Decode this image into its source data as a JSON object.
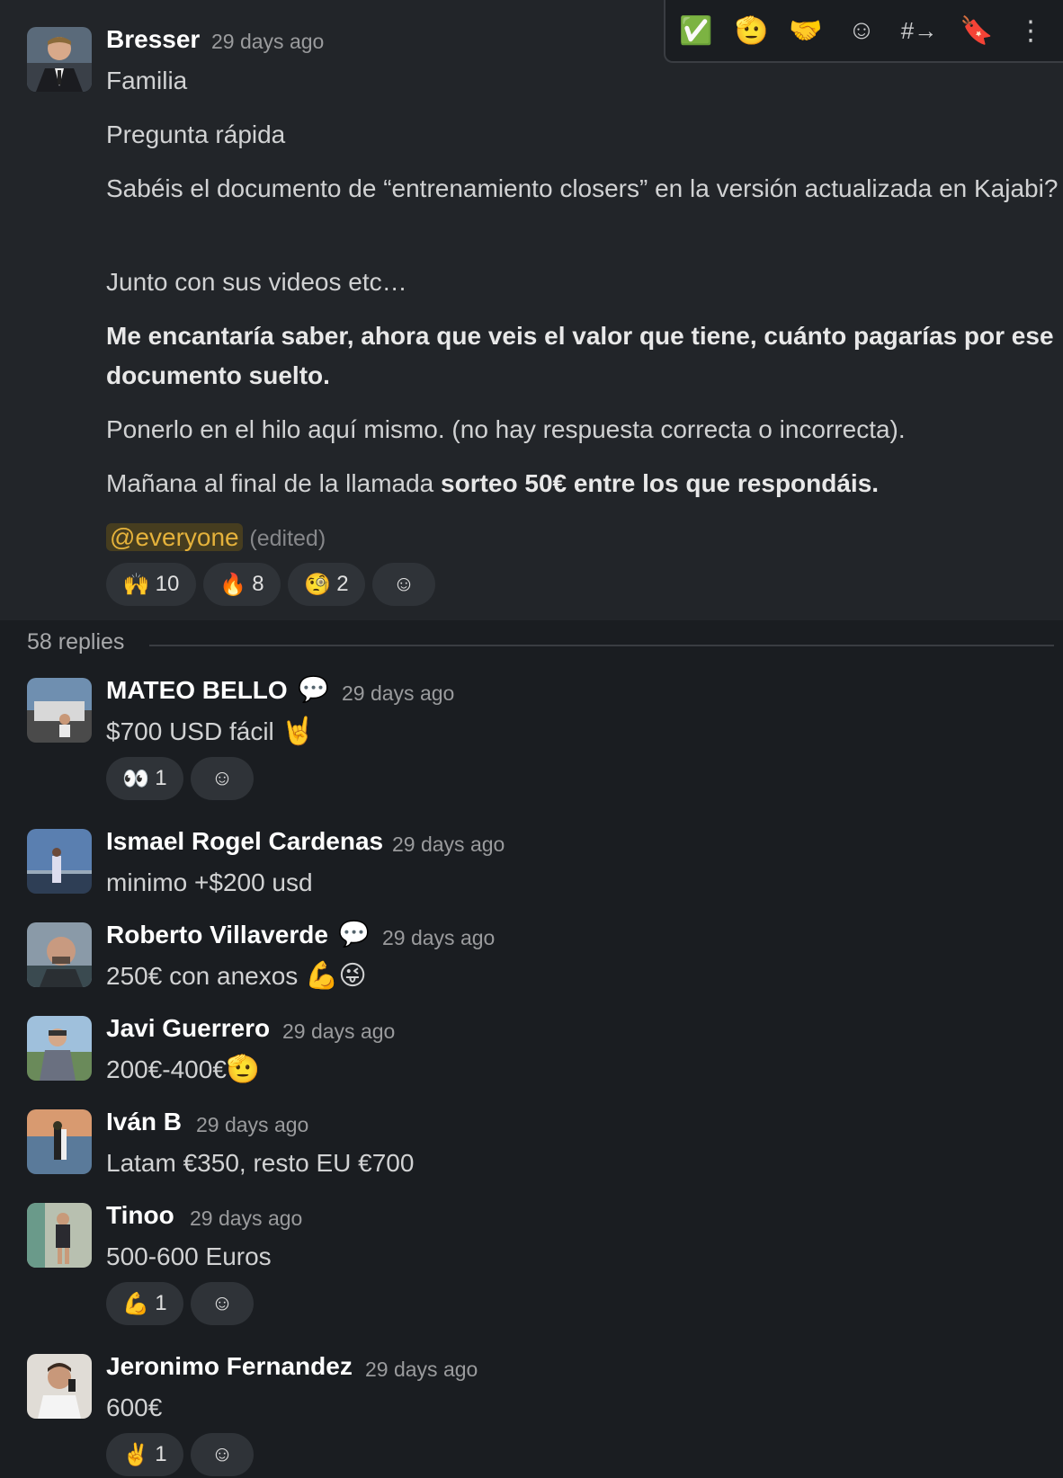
{
  "toolbar": {
    "icons": [
      "check-mark",
      "pointing-hand",
      "handshake",
      "add-reaction",
      "channel-link",
      "bookmark",
      "more"
    ],
    "glyphs": [
      "✅",
      "🫡",
      "🤝",
      "☺",
      "#→",
      "🔖",
      "⋮"
    ]
  },
  "parent": {
    "author": "Bresser",
    "time": "29 days ago",
    "lines": {
      "l1": "Familia",
      "l2": "Pregunta rápida",
      "l3": "Sabéis el documento de “entrenamiento closers” en la versión actualizada en Kajabi?",
      "l4": "Junto con sus videos etc…",
      "l5": "Me encantaría saber, ahora que veis el valor que tiene, cuánto pagarías por ese documento suelto.",
      "l6": "Ponerlo en el hilo aquí mismo. (no hay respuesta correcta o incorrecta).",
      "l7a": "Mañana al final de la llamada ",
      "l7b": "sorteo 50€ entre los que respondáis."
    },
    "mention": "@everyone",
    "edited": "(edited)",
    "reactions": [
      {
        "emoji": "🙌",
        "count": "10"
      },
      {
        "emoji": "🔥",
        "count": "8"
      },
      {
        "emoji": "🧐",
        "count": "2"
      }
    ]
  },
  "replies_label": "58 replies",
  "replies": [
    {
      "author": "MATEO BELLO",
      "badge": "💬",
      "time": "29 days ago",
      "text": "$700 USD fácil",
      "emoji": "🤘",
      "reaction": {
        "emoji": "👀",
        "count": "1"
      }
    },
    {
      "author": "Ismael Rogel Cardenas",
      "time": "29 days ago",
      "text": "minimo +$200 usd"
    },
    {
      "author": "Roberto Villaverde",
      "badge": "💬",
      "time": "29 days ago",
      "text": "250€ con anexos",
      "emoji": "💪😜"
    },
    {
      "author": "Javi Guerrero",
      "time": "29 days ago",
      "text": "200€-400€",
      "emoji": "🫡"
    },
    {
      "author": "Iván B",
      "time": "29 days ago",
      "text": "Latam €350, resto EU €700"
    },
    {
      "author": "Tinoo",
      "time": "29 days ago",
      "text": "500-600 Euros",
      "reaction": {
        "emoji": "💪",
        "count": "1"
      }
    },
    {
      "author": "Jeronimo Fernandez",
      "time": "29 days ago",
      "text": "600€",
      "reaction": {
        "emoji": "✌️",
        "count": "1"
      }
    }
  ],
  "add_reaction_glyph": "☺"
}
